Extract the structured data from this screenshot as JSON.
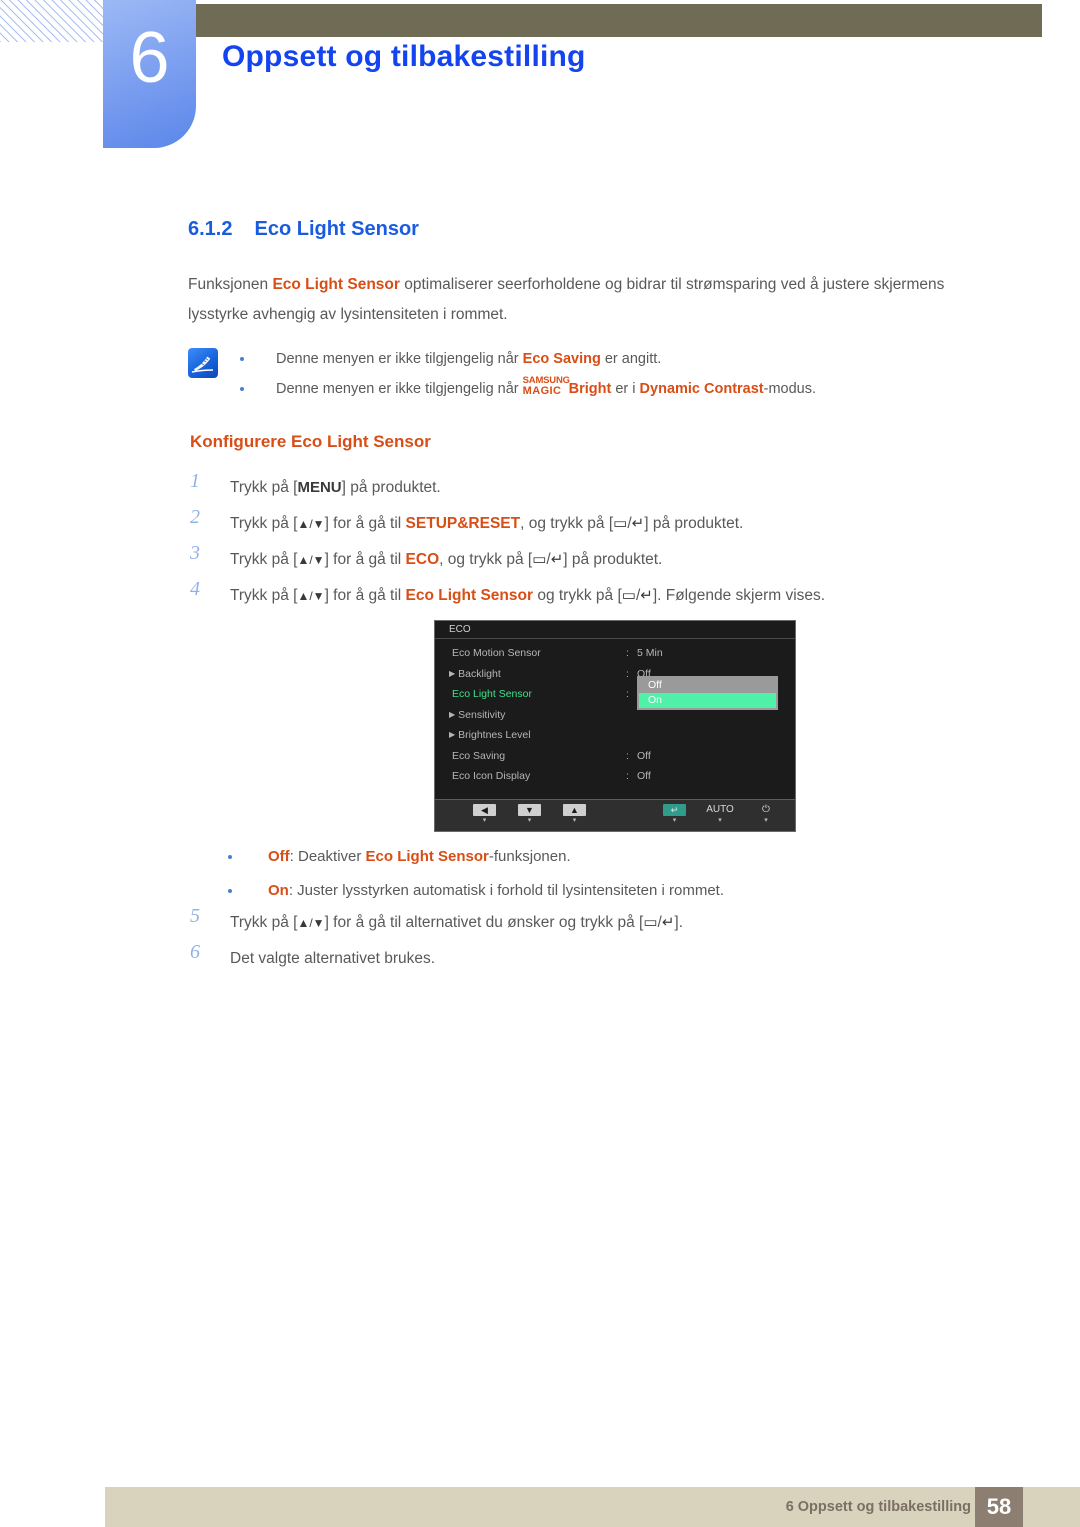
{
  "header": {
    "chapter_number": "6",
    "chapter_title": "Oppsett og tilbakestilling",
    "accent_blue": "#1344f0",
    "olive": "#6f6b55"
  },
  "section": {
    "number": "6.1.2",
    "title": "Eco Light Sensor",
    "intro_before": "Funksjonen ",
    "intro_term": "Eco Light Sensor",
    "intro_after": " optimaliserer seerforholdene og bidrar til strømsparing ved å justere skjermens lysstyrke avhengig av lysintensiteten i rommet."
  },
  "note": {
    "icon": "note-pen-icon",
    "bullets": [
      {
        "part1": "Denne menyen er ikke tilgjengelig når ",
        "term1": "Eco Saving",
        "part2": " er angitt."
      },
      {
        "part1": "Denne menyen er ikke tilgjengelig når ",
        "magic_sup": "SAMSUNG",
        "magic_main": "MAGIC",
        "magic_word": "Bright",
        "part2": " er i ",
        "term2": "Dynamic Contrast",
        "part3": "-modus."
      }
    ]
  },
  "configure": {
    "heading": "Konfigurere Eco Light Sensor",
    "steps": [
      {
        "num": "1",
        "a": "Trykk på [",
        "key": "MENU",
        "b": "] på produktet."
      },
      {
        "num": "2",
        "a": "Trykk på [",
        "arrows": "▲/▼",
        "b": "] for å gå til ",
        "term": "SETUP&RESET",
        "c": ", og trykk på [",
        "glyph1": "▭",
        "slash": "/",
        "glyph2": "↵",
        "d": "] på produktet."
      },
      {
        "num": "3",
        "a": "Trykk på [",
        "arrows": "▲/▼",
        "b": "] for å gå til ",
        "term": "ECO",
        "c": ", og trykk på [",
        "glyph1": "▭",
        "slash": "/",
        "glyph2": "↵",
        "d": "] på produktet."
      },
      {
        "num": "4",
        "a": "Trykk på [",
        "arrows": "▲/▼",
        "b": "] for å gå til ",
        "term": "Eco Light Sensor",
        "c": " og trykk på [",
        "glyph1": "▭",
        "slash": "/",
        "glyph2": "↵",
        "d": "]. Følgende skjerm vises."
      }
    ],
    "steps_after": [
      {
        "num": "5",
        "a": "Trykk på [",
        "arrows": "▲/▼",
        "b": "] for å gå til alternativet du ønsker og trykk på [",
        "glyph1": "▭",
        "slash": "/",
        "glyph2": "↵",
        "d": "]."
      },
      {
        "num": "6",
        "a": "Det valgte alternativet brukes.",
        "arrows": "",
        "b": "",
        "glyph1": "",
        "slash": "",
        "glyph2": "",
        "d": ""
      }
    ]
  },
  "osd": {
    "title": "ECO",
    "rows": [
      {
        "label": "Eco Motion Sensor",
        "arrow": "",
        "colon": ":",
        "value": "5 Min",
        "selected": false
      },
      {
        "label": "Backlight",
        "arrow": "▶",
        "colon": ":",
        "value": "Off",
        "selected": false
      },
      {
        "label": "Eco Light Sensor",
        "arrow": "",
        "colon": ":",
        "value": "",
        "selected": true
      },
      {
        "label": "Sensitivity",
        "arrow": "▶",
        "colon": "",
        "value": "",
        "selected": false
      },
      {
        "label": "Brightnes Level",
        "arrow": "▶",
        "colon": "",
        "value": "",
        "selected": false
      },
      {
        "label": "Eco Saving",
        "arrow": "",
        "colon": ":",
        "value": "Off",
        "selected": false
      },
      {
        "label": "Eco Icon Display",
        "arrow": "",
        "colon": ":",
        "value": "Off",
        "selected": false
      }
    ],
    "dropdown": {
      "options": [
        "Off",
        "On"
      ],
      "highlighted": "On",
      "highlight_color": "#4ff0a8"
    },
    "buttons": [
      {
        "glyph": "◀",
        "kind": "key",
        "sub": "▾"
      },
      {
        "glyph": "▼",
        "kind": "key",
        "sub": "▾"
      },
      {
        "glyph": "▲",
        "kind": "key",
        "sub": "▾"
      },
      {
        "glyph": "↵",
        "kind": "teal",
        "sub": "▾"
      },
      {
        "glyph": "AUTO",
        "kind": "bare",
        "sub": "▾"
      },
      {
        "glyph": "⏻",
        "kind": "bare",
        "sub": "▾"
      }
    ],
    "selected_label_color": "#3ee08a"
  },
  "options": [
    {
      "term": "Off",
      "a": ": Deaktiver ",
      "term2": "Eco Light Sensor",
      "b": "-funksjonen."
    },
    {
      "term": "On",
      "a": ": Juster lysstyrken automatisk i forhold til lysintensiteten i rommet.",
      "term2": "",
      "b": ""
    }
  ],
  "footer": {
    "text": "6 Oppsett og tilbakestilling",
    "page": "58",
    "bar_color": "#d9d3be",
    "page_box_color": "#8c7f72"
  }
}
